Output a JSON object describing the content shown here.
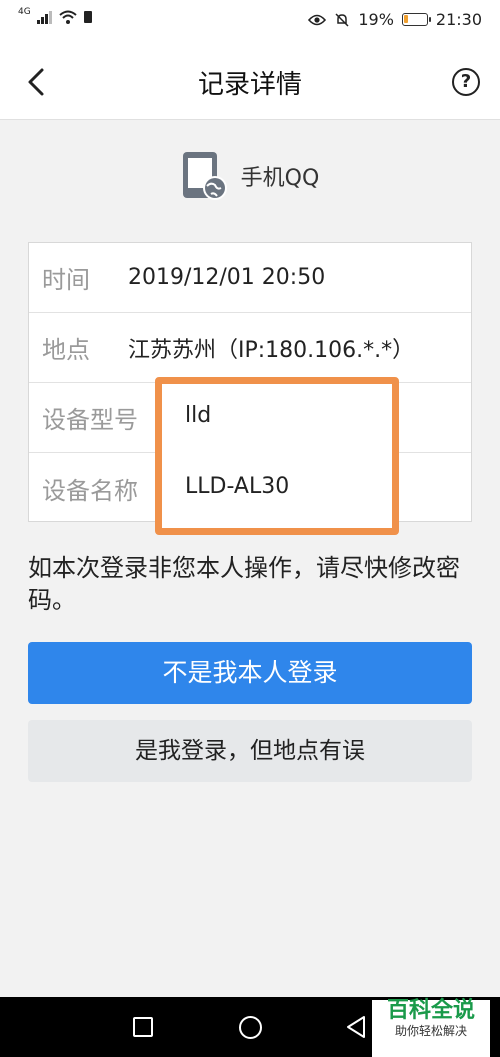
{
  "status_bar": {
    "network": "4G",
    "battery_text": "19%",
    "battery_level": 0.19,
    "time": "21:30"
  },
  "header": {
    "title": "记录详情",
    "help_symbol": "?"
  },
  "app": {
    "name": "手机QQ"
  },
  "record": {
    "rows": [
      {
        "label": "时间",
        "value": "2019/12/01 20:50"
      },
      {
        "label": "地点",
        "value": "江苏苏州（IP:180.106.*.*）"
      },
      {
        "label": "设备型号",
        "value": "lld"
      },
      {
        "label": "设备名称",
        "value": "LLD-AL30"
      }
    ]
  },
  "notice": "如本次登录非您本人操作，请尽快修改密码。",
  "buttons": {
    "not_me": "不是我本人登录",
    "wrong_location": "是我登录，但地点有误"
  },
  "watermark": {
    "title": "百科全说",
    "subtitle": "助你轻松解决"
  },
  "colors": {
    "primary": "#2f86eb",
    "highlight": "#f0914a",
    "watermark": "#1a9a4a"
  }
}
